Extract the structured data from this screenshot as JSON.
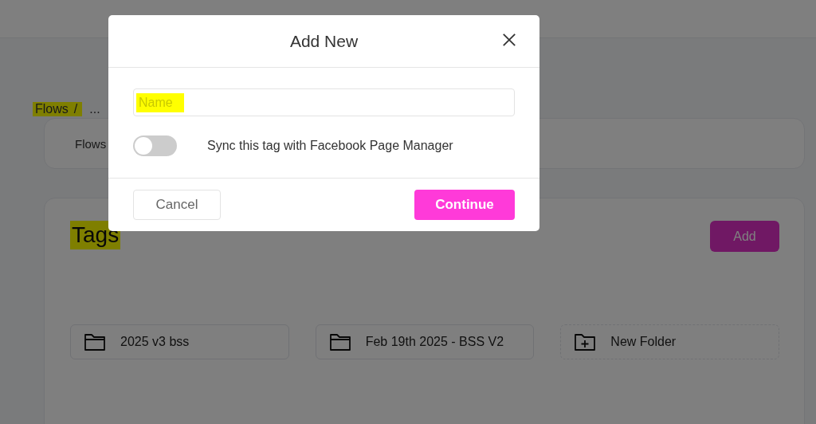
{
  "breadcrumb": [
    {
      "label": "Flows",
      "highlighted": true
    },
    {
      "label": "...",
      "highlighted": false
    }
  ],
  "breadcrumb_separator": "/",
  "flows_card": {
    "label": "Flows"
  },
  "tags_panel": {
    "title": "Tags",
    "title_highlighted": true,
    "add_button": "Add",
    "folders": [
      {
        "kind": "folder",
        "label": "2025 v3 bss"
      },
      {
        "kind": "folder",
        "label": "Feb 19th 2025 - BSS V2"
      },
      {
        "kind": "new",
        "label": "New Folder"
      }
    ]
  },
  "dialog": {
    "title": "Add New",
    "name_field": {
      "placeholder": "Name",
      "highlighted": true
    },
    "sync_toggle": {
      "on": false,
      "label": "Sync this tag with Facebook Page Manager"
    },
    "buttons": [
      {
        "kind": "secondary",
        "label": "Cancel"
      },
      {
        "kind": "primary",
        "label": "Continue"
      }
    ]
  }
}
